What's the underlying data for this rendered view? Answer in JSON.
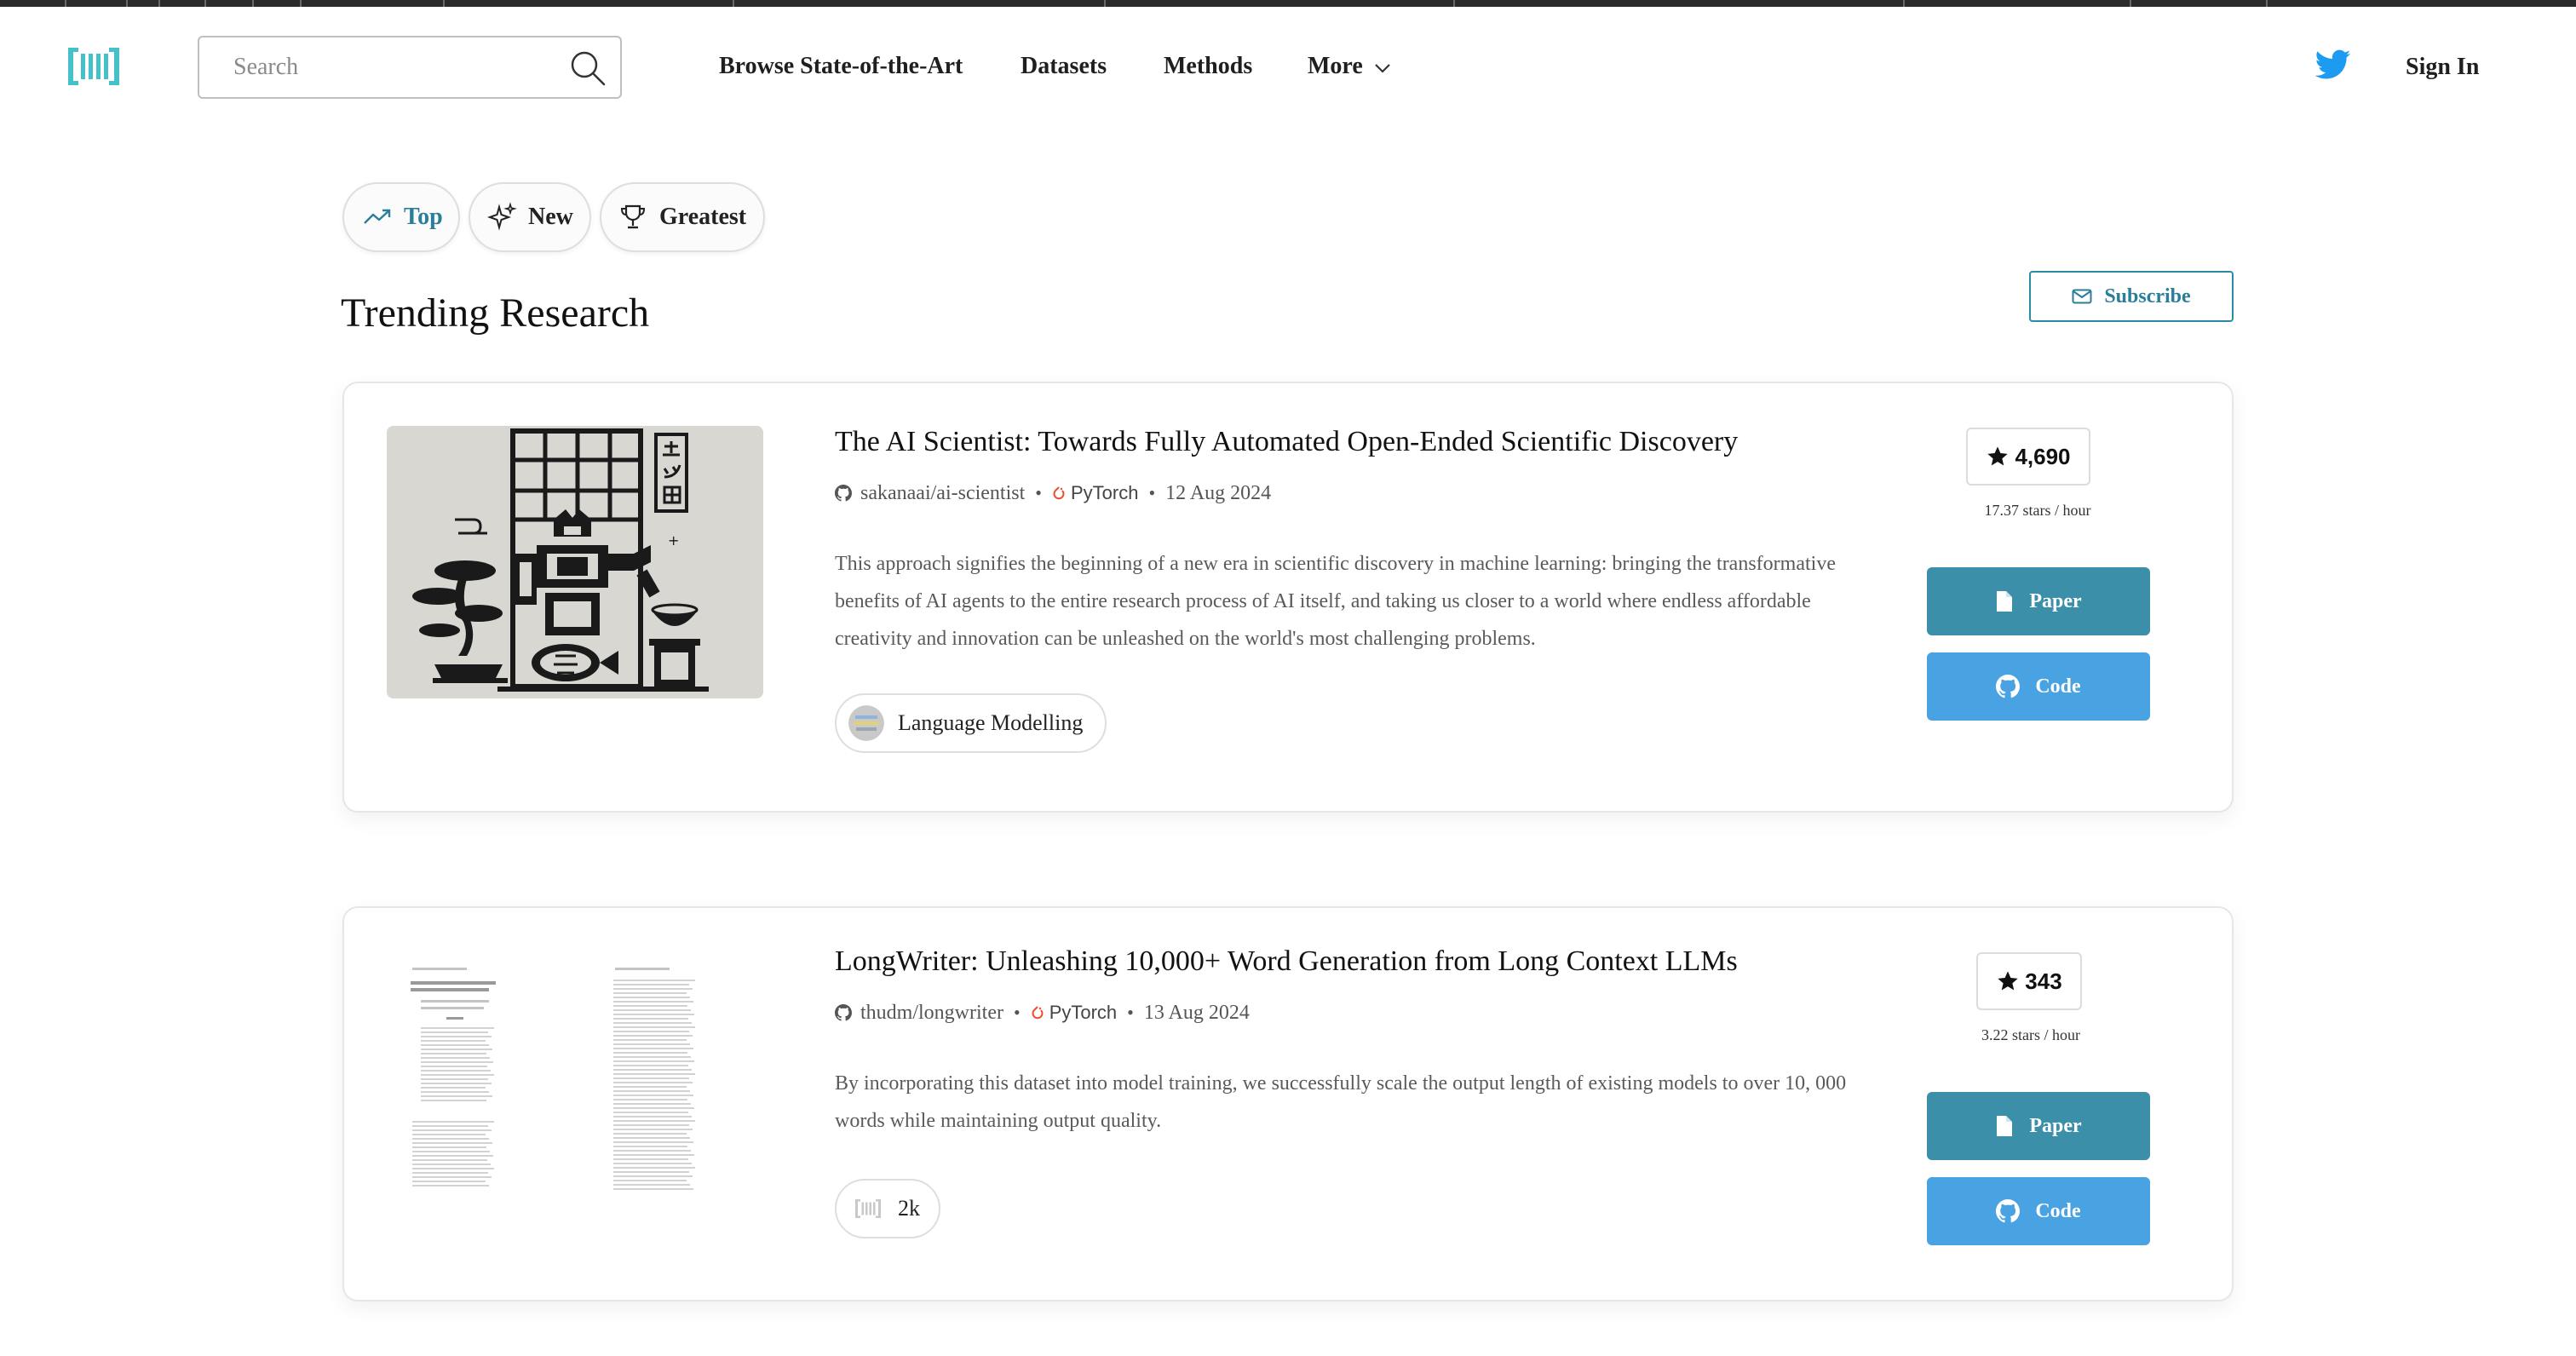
{
  "header": {
    "search_placeholder": "Search",
    "nav": [
      "Browse State-of-the-Art",
      "Datasets",
      "Methods",
      "More"
    ],
    "sign_in": "Sign In"
  },
  "tabs": [
    {
      "label": "Top",
      "icon": "trending-up-icon",
      "active": true
    },
    {
      "label": "New",
      "icon": "sparkles-icon",
      "active": false
    },
    {
      "label": "Greatest",
      "icon": "trophy-icon",
      "active": false
    }
  ],
  "page_title": "Trending Research",
  "subscribe_label": "Subscribe",
  "papers": [
    {
      "title": "The AI Scientist: Towards Fully Automated Open-Ended Scientific Discovery",
      "repo": "sakanaai/ai-scientist",
      "framework": "PyTorch",
      "date": "12 Aug 2024",
      "abstract": "This approach signifies the beginning of a new era in scientific discovery in machine learning: bringing the transformative benefits of AI agents to the entire research process of AI itself, and taking us closer to a world where endless affordable creativity and innovation can be unleashed on the world's most challenging problems.",
      "task": "Language Modelling",
      "stars": "4,690",
      "stars_rate": "17.37 stars / hour",
      "paper_label": "Paper",
      "code_label": "Code"
    },
    {
      "title": "LongWriter: Unleashing 10,000+ Word Generation from Long Context LLMs",
      "repo": "thudm/longwriter",
      "framework": "PyTorch",
      "date": "13 Aug 2024",
      "abstract": "By incorporating this dataset into model training, we successfully scale the output length of existing models to over 10, 000 words while maintaining output quality.",
      "task": "2k",
      "stars": "343",
      "stars_rate": "3.22 stars / hour",
      "paper_label": "Paper",
      "code_label": "Code"
    }
  ],
  "colors": {
    "accent": "#2a7e9a",
    "paper_button": "#3b8fa8",
    "code_button": "#49a2e2",
    "logo": "#45c1c9",
    "twitter": "#1d9bf0",
    "pytorch": "#ee4c2c"
  }
}
